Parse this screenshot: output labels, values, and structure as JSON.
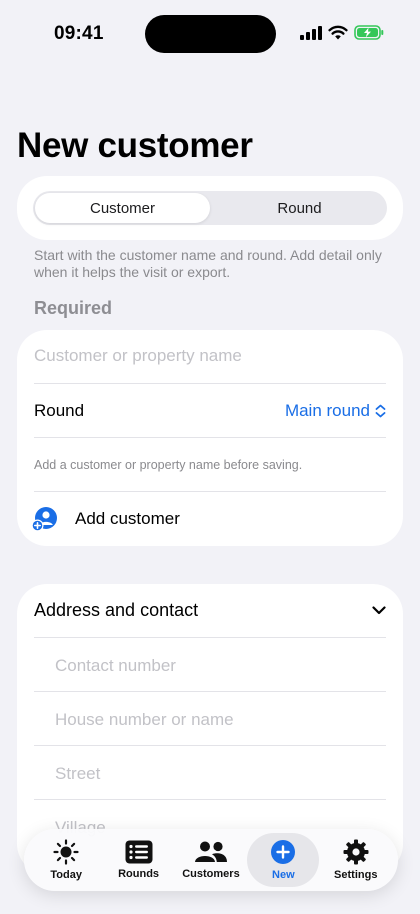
{
  "status_bar": {
    "time": "09:41"
  },
  "page": {
    "title": "New customer"
  },
  "segmented": {
    "items": [
      "Customer",
      "Round"
    ],
    "selected": "Customer"
  },
  "helper_text": "Start with the customer name and round. Add detail only when it helps the visit or export.",
  "required": {
    "label": "Required",
    "name_placeholder": "Customer or property name",
    "round_label": "Round",
    "round_value": "Main round",
    "note": "Add a customer or property name before saving.",
    "add_label": "Add customer"
  },
  "address": {
    "header": "Address and contact",
    "fields": [
      "Contact number",
      "House number or name",
      "Street",
      "Village"
    ]
  },
  "tabbar": {
    "items": [
      {
        "label": "Today",
        "icon": "sun-icon"
      },
      {
        "label": "Rounds",
        "icon": "list-icon"
      },
      {
        "label": "Customers",
        "icon": "people-icon"
      },
      {
        "label": "New",
        "icon": "plus-circle-icon"
      },
      {
        "label": "Settings",
        "icon": "gear-icon"
      }
    ],
    "active": "New"
  },
  "colors": {
    "accent": "#1a6ee6",
    "background": "#f2f2f7"
  }
}
